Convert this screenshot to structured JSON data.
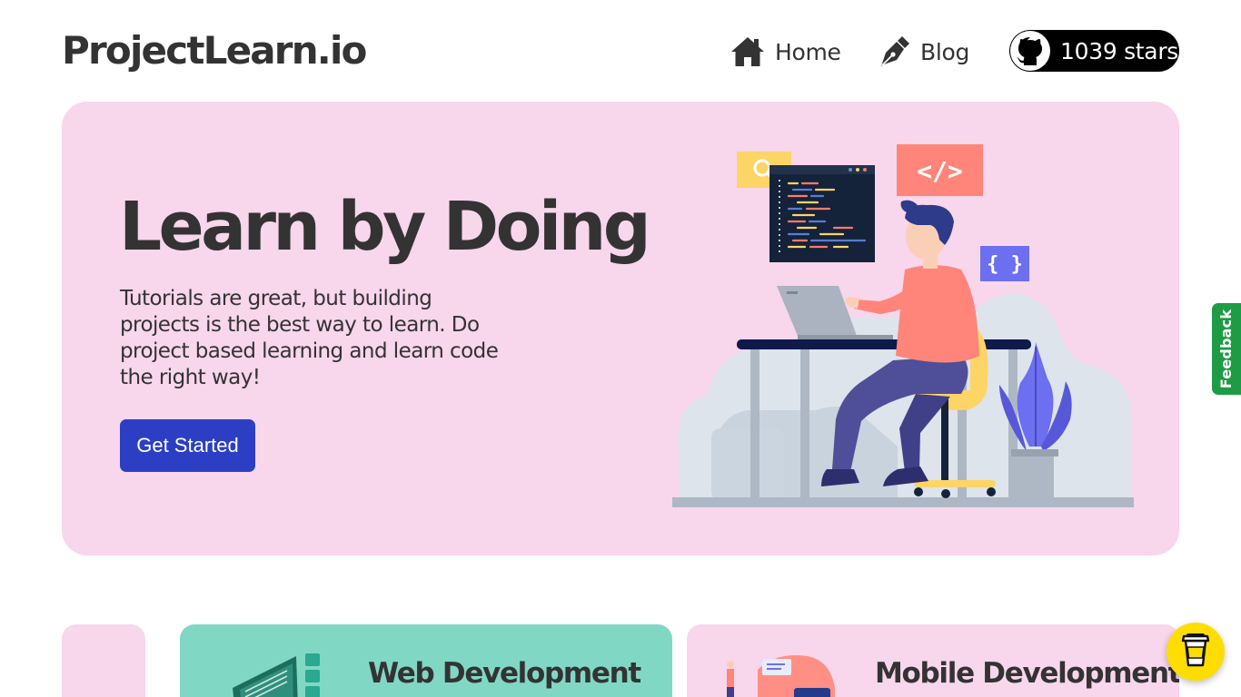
{
  "header": {
    "logo": "ProjectLearn.io",
    "nav": {
      "home_label": "Home",
      "blog_label": "Blog",
      "github_stars": "1039 stars"
    }
  },
  "hero": {
    "title": "Learn by Doing",
    "description": "Tutorials are great, but building projects is the best way to learn. Do project based learning and learn code the right way!",
    "cta_label": "Get Started",
    "illustration": {
      "code_tag": "</>",
      "braces_tag": "{ }"
    }
  },
  "feedback_tab": {
    "label": "Feedback"
  },
  "categories": [
    {
      "title": "Web Development"
    },
    {
      "title": "Mobile Development"
    }
  ],
  "icons": [
    "home-icon",
    "pen-icon",
    "github-icon",
    "search-icon",
    "coffee-cup-icon"
  ],
  "colors": {
    "hero_background": "#f8d6ec",
    "cta_background": "#2c3fc4",
    "web_card_background": "#80d8c4",
    "mobile_card_background": "#f8d6ec",
    "feedback_tab": "#1e9b45",
    "coffee_button": "#ffdd00",
    "stars_pill": "#000000"
  }
}
